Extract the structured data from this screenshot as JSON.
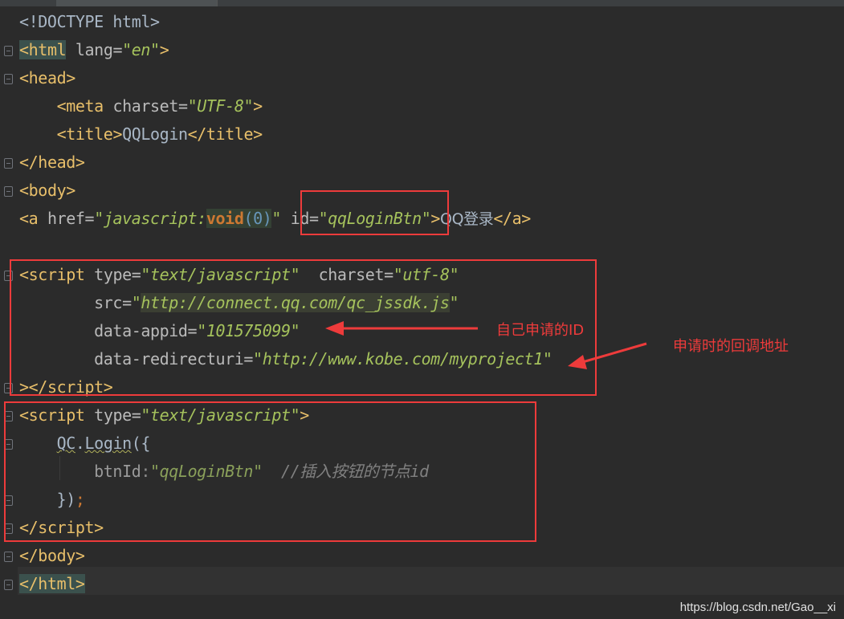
{
  "editor": {
    "tab_title": "",
    "lines": [
      {
        "doctype": "<!DOCTYPE html>"
      },
      {
        "html_open_tag": "html",
        "lang_attr": "lang=",
        "lang_value": "\"en\""
      },
      {
        "head_open": "head"
      },
      {
        "meta_tag": "meta",
        "charset_attr": "charset=",
        "charset_value": "\"UTF-8\""
      },
      {
        "title_open": "title",
        "title_text": "QQLogin",
        "title_close": "/title"
      },
      {
        "head_close": "/head"
      },
      {
        "body_open": "body"
      },
      {
        "a_tag": "a",
        "href_attr": "href=",
        "href_q1": "\"javascript:",
        "href_void": "void",
        "href_paren": "(0)",
        "href_q2": "\"",
        "id_attr": "id=",
        "id_value": "\"qqLoginBtn\"",
        "link_text": "QQ登录",
        "a_close": "/a"
      },
      {
        "script1_tag": "script",
        "type_attr": "type=",
        "type_value": "\"text/javascript\"",
        "charset_attr": "charset=",
        "charset_value": "\"utf-8\""
      },
      {
        "src_attr": "src=",
        "src_q1": "\"",
        "src_value": "http://connect.qq.com/qc_jssdk.js",
        "src_q2": "\""
      },
      {
        "appid_attr": "data-appid=",
        "appid_value": "\"101575099\""
      },
      {
        "redirect_attr": "data-redirecturi=",
        "redirect_value": "\"http://www.kobe.com/myproject1\""
      },
      {
        "script1_close": "/script"
      },
      {
        "script2_tag": "script",
        "type_attr": "type=",
        "type_value": "\"text/javascript\""
      },
      {
        "qc_obj": "QC",
        "dot": ".",
        "login_fn": "Login",
        "open_paren": "({"
      },
      {
        "btnid_key": "btnId",
        "colon": ":",
        "btnid_value": "\"qqLoginBtn\"",
        "comment": "//插入按钮的节点id"
      },
      {
        "close_paren": "})",
        "semicolon": ";"
      },
      {
        "script2_close": "/script"
      },
      {
        "body_close": "/body"
      },
      {
        "html_close": "/html"
      }
    ]
  },
  "annotations": {
    "appid_note": "自己申请的ID",
    "redirect_note": "申请时的回调地址",
    "color": "#ee3b3b"
  },
  "watermark": "https://blog.csdn.net/Gao__xi"
}
